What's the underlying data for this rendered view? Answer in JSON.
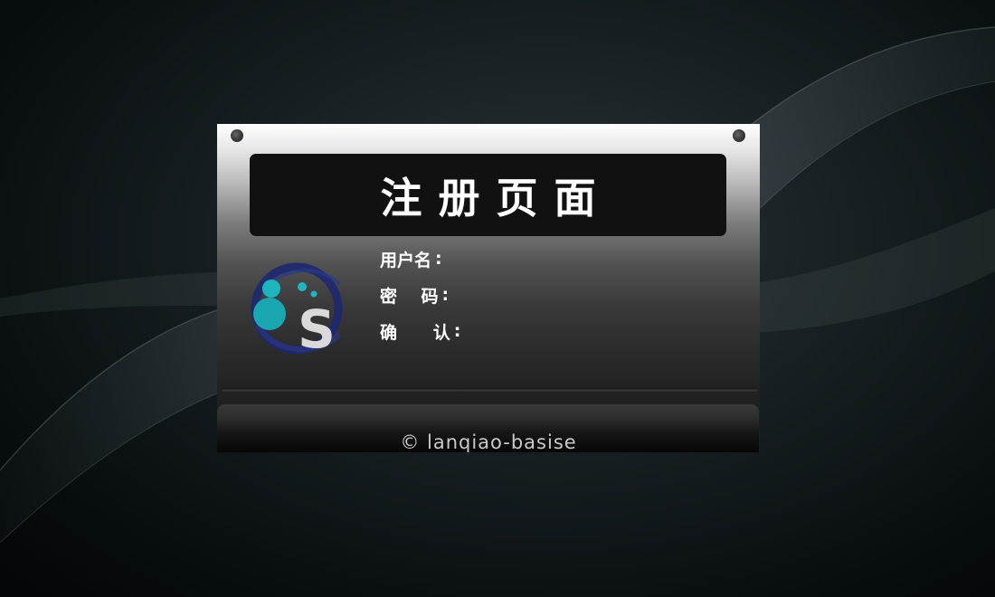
{
  "page": {
    "title": "注册页面"
  },
  "form": {
    "username_label": "用户名",
    "password_label": "密    码",
    "confirm_label": "确      认",
    "colon": ":"
  },
  "footer": {
    "copyright": "© lanqiao-basise"
  },
  "logo": {
    "letter": "S",
    "icon": "brand-logo"
  },
  "colors": {
    "accent": "#19a7b2",
    "logo_ring": "#1f2a6b",
    "title_bar": "#111111"
  }
}
